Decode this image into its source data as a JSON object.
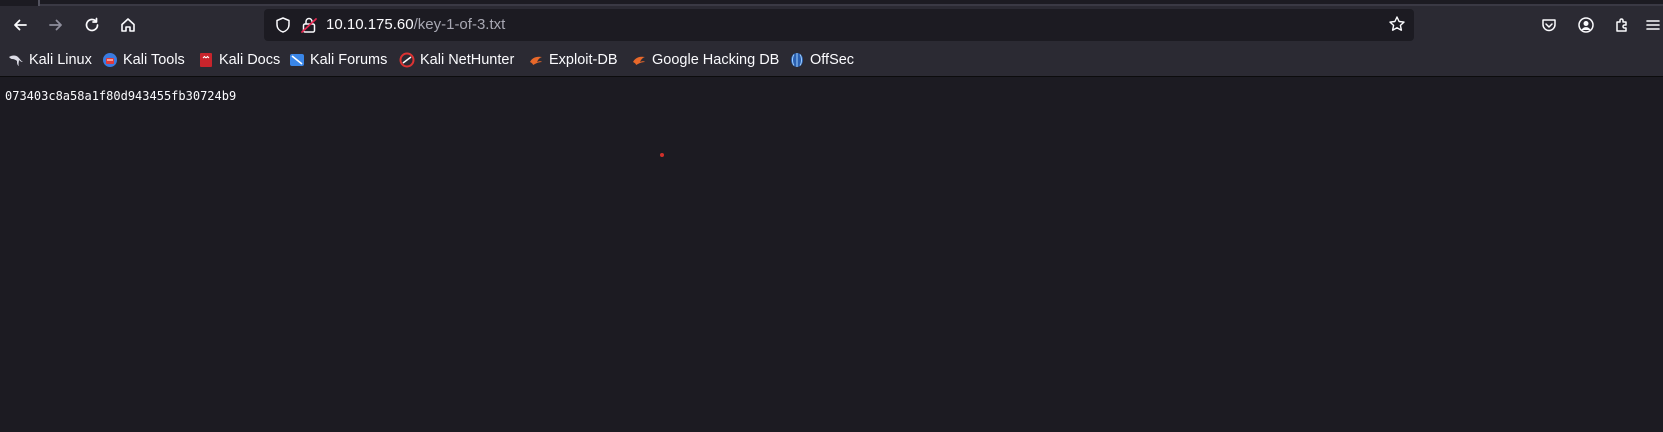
{
  "browser": {
    "url_host": "10.10.175.60",
    "url_path": "/key-1-of-3.txt",
    "icons": {
      "back": "back-arrow-icon",
      "forward": "forward-arrow-icon",
      "reload": "reload-icon",
      "home": "home-icon",
      "shield": "tracking-shield-icon",
      "lock": "insecure-lock-icon",
      "star": "bookmark-star-icon",
      "pocket": "pocket-icon",
      "account": "account-icon",
      "extensions": "extensions-icon",
      "menu": "hamburger-menu-icon"
    }
  },
  "bookmarks": [
    {
      "label": "Kali Linux",
      "icon": "kali-dragon-icon"
    },
    {
      "label": "Kali Tools",
      "icon": "kali-tools-icon"
    },
    {
      "label": "Kali Docs",
      "icon": "kali-docs-icon"
    },
    {
      "label": "Kali Forums",
      "icon": "kali-forums-icon"
    },
    {
      "label": "Kali NetHunter",
      "icon": "kali-nethunter-icon"
    },
    {
      "label": "Exploit-DB",
      "icon": "exploit-db-icon"
    },
    {
      "label": "Google Hacking DB",
      "icon": "ghdb-icon"
    },
    {
      "label": "OffSec",
      "icon": "offsec-icon"
    }
  ],
  "page": {
    "text": "073403c8a58a1f80d943455fb30724b9"
  },
  "colors": {
    "toolbar": "#2b2a33",
    "content_bg": "#1c1b22",
    "text": "#fbfbfe",
    "url_path": "#a8a8b3"
  }
}
